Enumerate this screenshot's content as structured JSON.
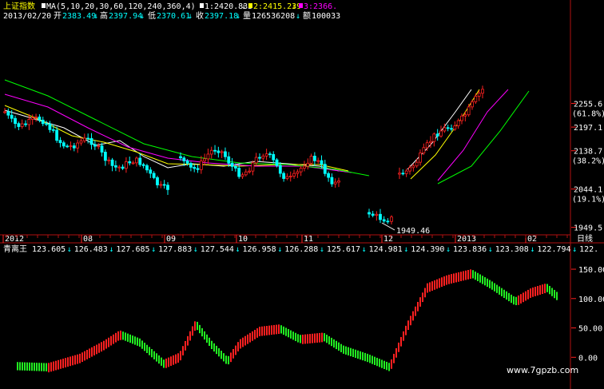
{
  "header": {
    "index_name": "上证指数",
    "ma_label": "MA(5,10,20,30,60,120,240,360,4)",
    "m1": "1:2420.833",
    "m2": "2:2415.239",
    "m3": "3:2366.",
    "date": "2013/02/20",
    "open_label": "开",
    "open": "2383.49",
    "high_label": "高",
    "high": "2397.94",
    "low_label": "低",
    "low": "2370.61",
    "close_label": "收",
    "close": "2397.18",
    "vol_label": "量",
    "vol": "126536208",
    "amt_label": "额",
    "amt": "100033"
  },
  "indicator": {
    "name": "青离王",
    "values": [
      "123.605",
      "126.483",
      "127.685",
      "127.883",
      "127.544",
      "126.958",
      "126.288",
      "125.617",
      "124.981",
      "124.390",
      "123.836",
      "123.308",
      "122.794",
      "122."
    ]
  },
  "period_label": "日线",
  "watermark": "www.7gpzb.com",
  "low_mark": "1949.46",
  "colors": {
    "up": "#ff2020",
    "down": "#00ffff",
    "ind_up": "#ff2020",
    "ind_down": "#22ee22",
    "grid": "#b01010",
    "axis": "#ff2020"
  },
  "chart_data": [
    {
      "type": "candlestick",
      "y_ticks": [
        {
          "value": "2255.6",
          "pct": "(61.8%)"
        },
        {
          "value": "2197.1",
          "pct": ""
        },
        {
          "value": "2138.7",
          "pct": "(38.2%)"
        },
        {
          "value": "2044.1",
          "pct": "(19.1%)"
        },
        {
          "value": "1949.5",
          "pct": ""
        }
      ],
      "x_ticks": [
        "2012",
        "08",
        "09",
        "10",
        "11",
        "12",
        "2013",
        "02"
      ],
      "ylim": [
        1935,
        2290
      ]
    },
    {
      "type": "bar",
      "y_ticks": [
        "150.00",
        "100.00",
        "50.00",
        "0.00"
      ],
      "ylim": [
        -20,
        165
      ]
    }
  ]
}
